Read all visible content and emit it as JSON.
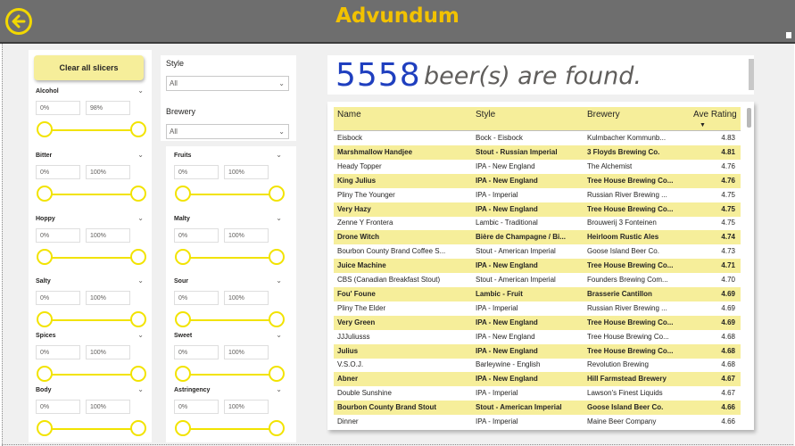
{
  "app": {
    "title": "Advundum"
  },
  "clear_button": {
    "label": "Clear all slicers"
  },
  "dropdowns": {
    "style": {
      "label": "Style",
      "value": "All"
    },
    "brewery": {
      "label": "Brewery",
      "value": "All"
    }
  },
  "slicers": {
    "alcohol": {
      "title": "Alcohol",
      "min": "0%",
      "max": "98%"
    },
    "bitter": {
      "title": "Bitter",
      "min": "0%",
      "max": "100%"
    },
    "fruits": {
      "title": "Fruits",
      "min": "0%",
      "max": "100%"
    },
    "hoppy": {
      "title": "Hoppy",
      "min": "0%",
      "max": "100%"
    },
    "malty": {
      "title": "Malty",
      "min": "0%",
      "max": "100%"
    },
    "salty": {
      "title": "Salty",
      "min": "0%",
      "max": "100%"
    },
    "sour": {
      "title": "Sour",
      "min": "0%",
      "max": "100%"
    },
    "spices": {
      "title": "Spices",
      "min": "0%",
      "max": "100%"
    },
    "sweet": {
      "title": "Sweet",
      "min": "0%",
      "max": "100%"
    },
    "body": {
      "title": "Body",
      "min": "0%",
      "max": "100%"
    },
    "astringency": {
      "title": "Astringency",
      "min": "0%",
      "max": "100%"
    }
  },
  "summary": {
    "count": "5558",
    "text": "beer(s) are found."
  },
  "table": {
    "headers": {
      "name": "Name",
      "style": "Style",
      "brewery": "Brewery",
      "rating": "Ave Rating"
    },
    "rows": [
      {
        "name": "Eisbock",
        "style": "Bock - Eisbock",
        "brewery": "Kulmbacher Kommunb...",
        "rating": "4.83"
      },
      {
        "name": "Marshmallow Handjee",
        "style": "Stout - Russian Imperial",
        "brewery": "3 Floyds Brewing Co.",
        "rating": "4.81"
      },
      {
        "name": "Heady Topper",
        "style": "IPA - New England",
        "brewery": "The Alchemist",
        "rating": "4.76"
      },
      {
        "name": "King Julius",
        "style": "IPA - New England",
        "brewery": "Tree House Brewing Co...",
        "rating": "4.76"
      },
      {
        "name": "Pliny The Younger",
        "style": "IPA - Imperial",
        "brewery": "Russian River Brewing ...",
        "rating": "4.75"
      },
      {
        "name": "Very Hazy",
        "style": "IPA - New England",
        "brewery": "Tree House Brewing Co...",
        "rating": "4.75"
      },
      {
        "name": "Zenne Y Frontera",
        "style": "Lambic - Traditional",
        "brewery": "Brouwerij 3 Fonteinen",
        "rating": "4.75"
      },
      {
        "name": "Drone Witch",
        "style": "Bière de Champagne / Bi...",
        "brewery": "Heirloom Rustic Ales",
        "rating": "4.74"
      },
      {
        "name": "Bourbon County Brand Coffee S...",
        "style": "Stout - American Imperial",
        "brewery": "Goose Island Beer Co.",
        "rating": "4.73"
      },
      {
        "name": "Juice Machine",
        "style": "IPA - New England",
        "brewery": "Tree House Brewing Co...",
        "rating": "4.71"
      },
      {
        "name": "CBS (Canadian Breakfast Stout)",
        "style": "Stout - American Imperial",
        "brewery": "Founders Brewing Com...",
        "rating": "4.70"
      },
      {
        "name": "Fou' Foune",
        "style": "Lambic - Fruit",
        "brewery": "Brasserie Cantillon",
        "rating": "4.69"
      },
      {
        "name": "Pliny The Elder",
        "style": "IPA - Imperial",
        "brewery": "Russian River Brewing ...",
        "rating": "4.69"
      },
      {
        "name": "Very Green",
        "style": "IPA - New England",
        "brewery": "Tree House Brewing Co...",
        "rating": "4.69"
      },
      {
        "name": "JJJuliusss",
        "style": "IPA - New England",
        "brewery": "Tree House Brewing Co...",
        "rating": "4.68"
      },
      {
        "name": "Julius",
        "style": "IPA - New England",
        "brewery": "Tree House Brewing Co...",
        "rating": "4.68"
      },
      {
        "name": "V.S.O.J.",
        "style": "Barleywine - English",
        "brewery": "Revolution Brewing",
        "rating": "4.68"
      },
      {
        "name": "Abner",
        "style": "IPA - New England",
        "brewery": "Hill Farmstead Brewery",
        "rating": "4.67"
      },
      {
        "name": "Double Sunshine",
        "style": "IPA - Imperial",
        "brewery": "Lawson's Finest Liquids",
        "rating": "4.67"
      },
      {
        "name": "Bourbon County Brand Stout",
        "style": "Stout - American Imperial",
        "brewery": "Goose Island Beer Co.",
        "rating": "4.66"
      },
      {
        "name": "Dinner",
        "style": "IPA - Imperial",
        "brewery": "Maine Beer Company",
        "rating": "4.66"
      }
    ]
  },
  "icons": {
    "back": "arrow-left-circle-icon",
    "sort": "sort-descending-icon",
    "chevron": "chevron-down-icon"
  },
  "colors": {
    "accent": "#f2e300",
    "title": "#f2c200",
    "row_highlight": "#f6ee9a",
    "count": "#1f3fbf"
  }
}
